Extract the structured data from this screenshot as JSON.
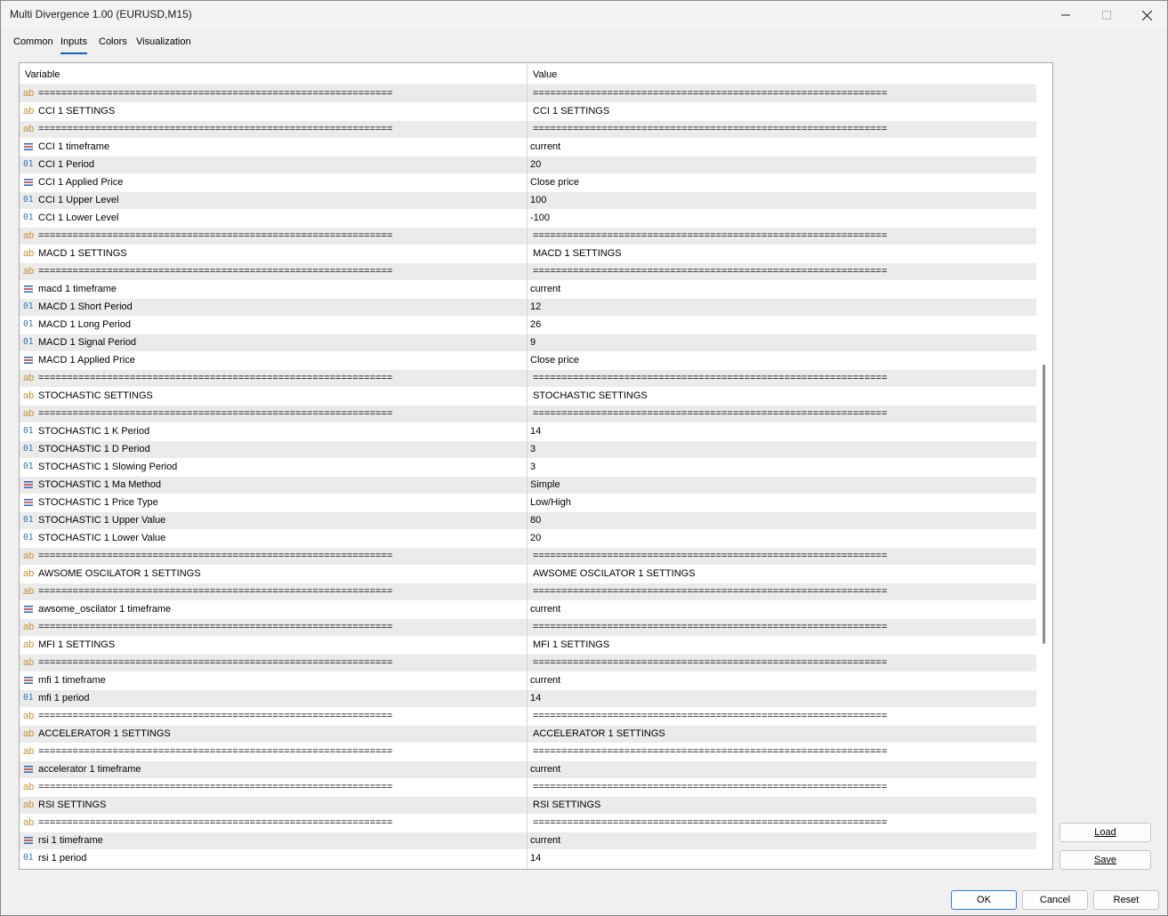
{
  "window": {
    "title": "Multi Divergence 1.00 (EURUSD,M15)"
  },
  "tabs": [
    "Common",
    "Inputs",
    "Colors",
    "Visualization"
  ],
  "active_tab": "Inputs",
  "grid": {
    "headers": {
      "variable": "Variable",
      "value": "Value"
    },
    "rows": [
      {
        "type": "ab",
        "name": "==============================================================",
        "value": "=============================================================="
      },
      {
        "type": "ab",
        "name": "CCI 1 SETTINGS",
        "value": "CCI 1 SETTINGS"
      },
      {
        "type": "ab",
        "name": "==============================================================",
        "value": "=============================================================="
      },
      {
        "type": "enum",
        "name": "CCI 1 timeframe",
        "value": "current"
      },
      {
        "type": "num",
        "name": "CCI 1 Period",
        "value": "20"
      },
      {
        "type": "enum",
        "name": "CCI 1 Applied Price",
        "value": "Close price"
      },
      {
        "type": "num",
        "name": "CCI 1 Upper Level",
        "value": "100"
      },
      {
        "type": "num",
        "name": "CCI 1 Lower Level",
        "value": "-100"
      },
      {
        "type": "ab",
        "name": "==============================================================",
        "value": "=============================================================="
      },
      {
        "type": "ab",
        "name": "MACD 1 SETTINGS",
        "value": "MACD 1 SETTINGS"
      },
      {
        "type": "ab",
        "name": "==============================================================",
        "value": "=============================================================="
      },
      {
        "type": "enum",
        "name": "macd 1 timeframe",
        "value": "current"
      },
      {
        "type": "num",
        "name": "MACD 1 Short Period",
        "value": "12"
      },
      {
        "type": "num",
        "name": "MACD 1 Long Period",
        "value": "26"
      },
      {
        "type": "num",
        "name": "MACD 1 Signal Period",
        "value": "9"
      },
      {
        "type": "enum",
        "name": "MACD 1 Applied Price",
        "value": "Close price"
      },
      {
        "type": "ab",
        "name": "==============================================================",
        "value": "=============================================================="
      },
      {
        "type": "ab",
        "name": "STOCHASTIC  SETTINGS",
        "value": "STOCHASTIC  SETTINGS"
      },
      {
        "type": "ab",
        "name": "==============================================================",
        "value": "=============================================================="
      },
      {
        "type": "num",
        "name": "STOCHASTIC 1 K Period",
        "value": "14"
      },
      {
        "type": "num",
        "name": "STOCHASTIC 1 D Period",
        "value": "3"
      },
      {
        "type": "num",
        "name": "STOCHASTIC 1 Slowing Period",
        "value": "3"
      },
      {
        "type": "enum",
        "name": "STOCHASTIC 1 Ma Method",
        "value": "Simple"
      },
      {
        "type": "enum",
        "name": "STOCHASTIC 1 Price Type",
        "value": "Low/High"
      },
      {
        "type": "num",
        "name": "STOCHASTIC 1 Upper Value",
        "value": "80"
      },
      {
        "type": "num",
        "name": "STOCHASTIC 1 Lower Value",
        "value": "20"
      },
      {
        "type": "ab",
        "name": "==============================================================",
        "value": "=============================================================="
      },
      {
        "type": "ab",
        "name": "AWSOME OSCILATOR 1 SETTINGS",
        "value": "AWSOME OSCILATOR 1 SETTINGS"
      },
      {
        "type": "ab",
        "name": "==============================================================",
        "value": "=============================================================="
      },
      {
        "type": "enum",
        "name": "awsome_oscilator 1 timeframe",
        "value": "current"
      },
      {
        "type": "ab",
        "name": "==============================================================",
        "value": "=============================================================="
      },
      {
        "type": "ab",
        "name": "MFI 1 SETTINGS",
        "value": "MFI 1 SETTINGS"
      },
      {
        "type": "ab",
        "name": "==============================================================",
        "value": "=============================================================="
      },
      {
        "type": "enum",
        "name": "mfi 1 timeframe",
        "value": "current"
      },
      {
        "type": "num",
        "name": "mfi 1 period",
        "value": "14"
      },
      {
        "type": "ab",
        "name": "==============================================================",
        "value": "=============================================================="
      },
      {
        "type": "ab",
        "name": "ACCELERATOR 1 SETTINGS",
        "value": "ACCELERATOR 1 SETTINGS"
      },
      {
        "type": "ab",
        "name": "==============================================================",
        "value": "=============================================================="
      },
      {
        "type": "enum",
        "name": "accelerator 1 timeframe",
        "value": "current"
      },
      {
        "type": "ab",
        "name": "==============================================================",
        "value": "=============================================================="
      },
      {
        "type": "ab",
        "name": "RSI SETTINGS",
        "value": "RSI SETTINGS"
      },
      {
        "type": "ab",
        "name": "==============================================================",
        "value": "=============================================================="
      },
      {
        "type": "enum",
        "name": "rsi 1 timeframe",
        "value": "current"
      },
      {
        "type": "num",
        "name": "rsi 1 period",
        "value": "14"
      }
    ]
  },
  "side_buttons": {
    "load": "Load",
    "save": "Save"
  },
  "footer": {
    "ok": "OK",
    "cancel": "Cancel",
    "reset": "Reset"
  },
  "icons": {
    "ab": "ab",
    "num": "01"
  },
  "colors": {
    "accent": "#0a64c8",
    "row_alt": "#ebebeb",
    "ab_icon": "#c8902b",
    "num_icon": "#2a6fc4"
  }
}
